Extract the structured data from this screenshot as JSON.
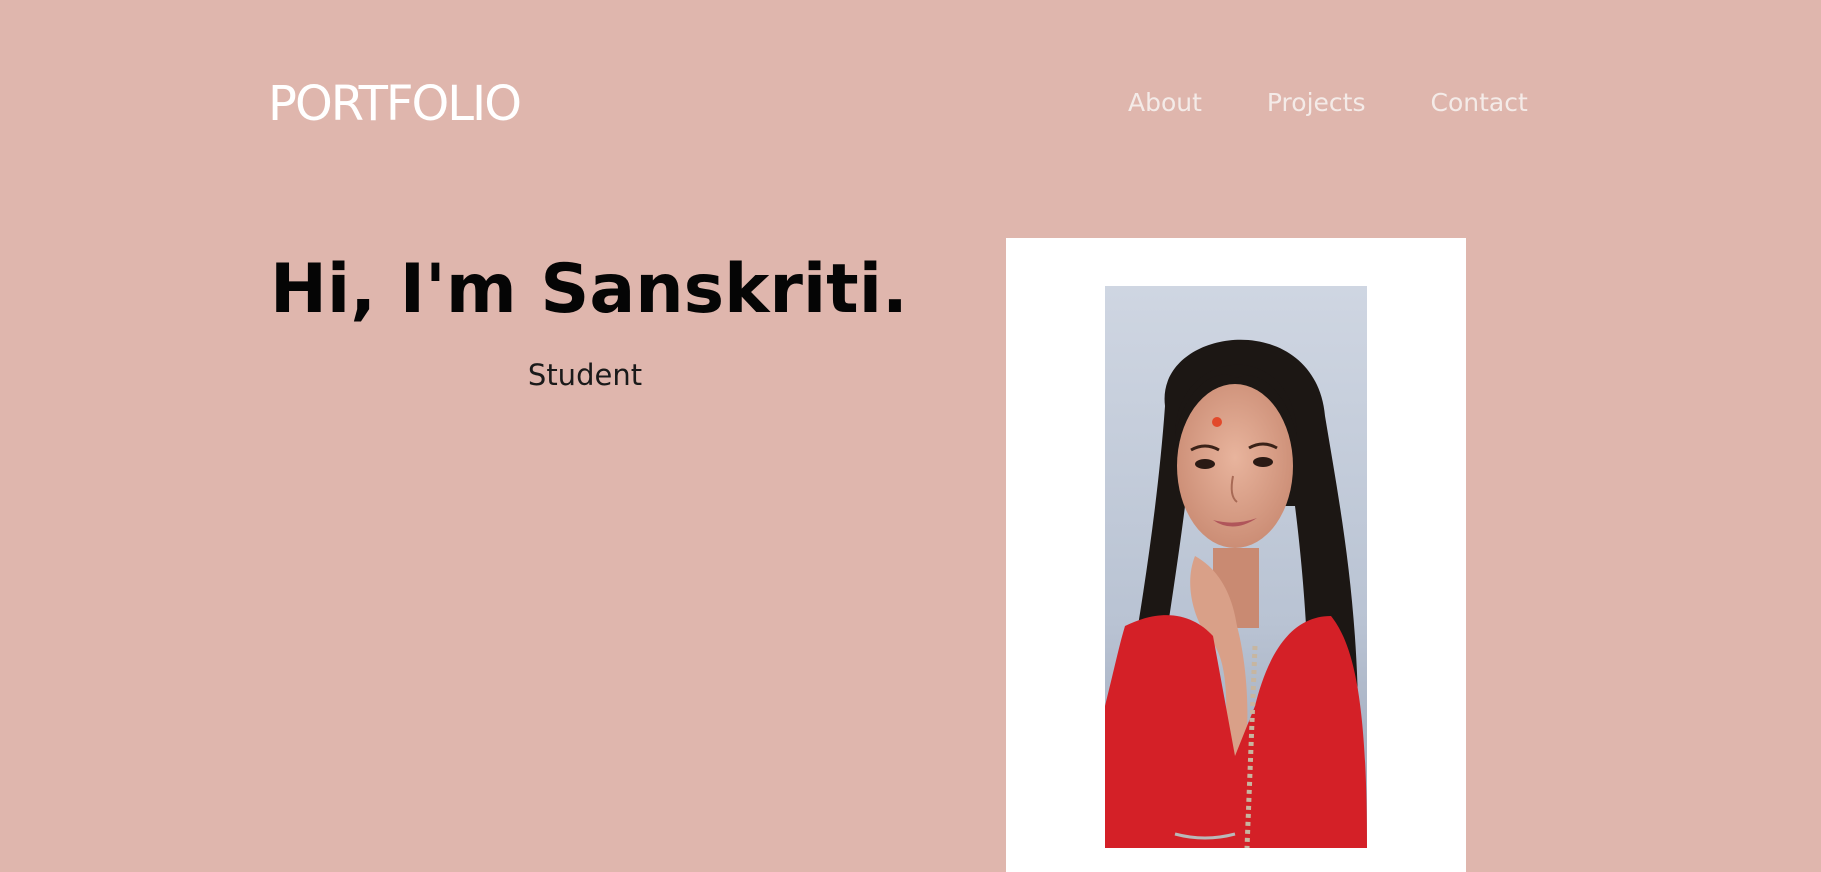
{
  "header": {
    "logo": "PORTFOLIO",
    "nav": [
      "About",
      "Projects",
      "Contact"
    ]
  },
  "hero": {
    "title": "Hi, I'm Sanskriti.",
    "subtitle": "Student"
  },
  "colors": {
    "background": "#dfb6ad",
    "logo": "#ffffff",
    "nav": "#f4ebe8",
    "title": "#050505",
    "card": "#ffffff"
  }
}
